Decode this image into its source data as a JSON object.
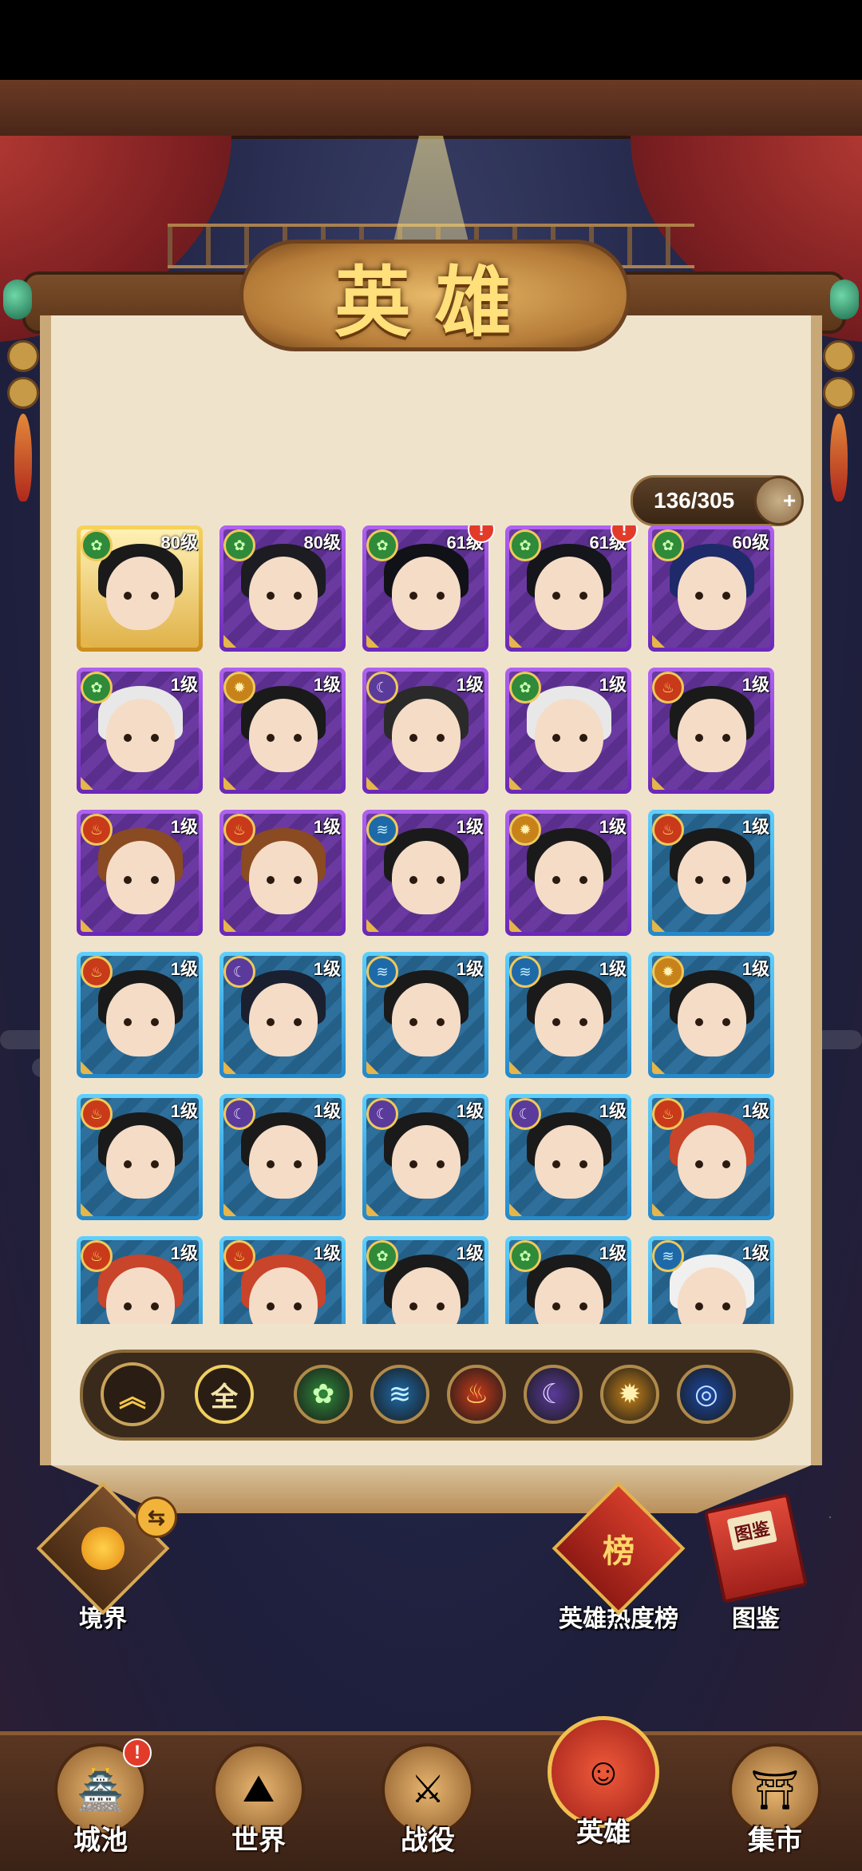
{
  "title": "英雄",
  "capacity": "136/305",
  "capacity_add_icon": "plus-icon",
  "heroes": [
    {
      "level": "80级",
      "element": "nature",
      "frame": "gold",
      "alert": false,
      "hair": "#1a1a1a"
    },
    {
      "level": "80级",
      "element": "nature",
      "frame": "purple",
      "alert": false,
      "hair": "#1c1c22"
    },
    {
      "level": "61级",
      "element": "nature",
      "frame": "purple",
      "alert": true,
      "hair": "#111118"
    },
    {
      "level": "61级",
      "element": "nature",
      "frame": "purple",
      "alert": true,
      "hair": "#15151c"
    },
    {
      "level": "60级",
      "element": "nature",
      "frame": "purple",
      "alert": false,
      "hair": "#1f2a6a"
    },
    {
      "level": "1级",
      "element": "nature",
      "frame": "purple",
      "alert": false,
      "hair": "#e8e8e8"
    },
    {
      "level": "1级",
      "element": "sun",
      "frame": "purple",
      "alert": false,
      "hair": "#1a1a1a"
    },
    {
      "level": "1级",
      "element": "moon",
      "frame": "purple",
      "alert": false,
      "hair": "#2a2a2a"
    },
    {
      "level": "1级",
      "element": "nature",
      "frame": "purple",
      "alert": false,
      "hair": "#e8e8e8"
    },
    {
      "level": "1级",
      "element": "fire",
      "frame": "purple",
      "alert": false,
      "hair": "#1a1a1a"
    },
    {
      "level": "1级",
      "element": "fire",
      "frame": "purple",
      "alert": false,
      "hair": "#8a4a22"
    },
    {
      "level": "1级",
      "element": "fire",
      "frame": "purple",
      "alert": false,
      "hair": "#8a4a22"
    },
    {
      "level": "1级",
      "element": "water",
      "frame": "purple",
      "alert": false,
      "hair": "#1a1a1a"
    },
    {
      "level": "1级",
      "element": "sun",
      "frame": "purple",
      "alert": false,
      "hair": "#1a1a1a"
    },
    {
      "level": "1级",
      "element": "fire",
      "frame": "blue",
      "alert": false,
      "hair": "#1a1a1a"
    },
    {
      "level": "1级",
      "element": "fire",
      "frame": "blue",
      "alert": false,
      "hair": "#1a1a1a"
    },
    {
      "level": "1级",
      "element": "moon",
      "frame": "blue",
      "alert": false,
      "hair": "#1a2030"
    },
    {
      "level": "1级",
      "element": "water",
      "frame": "blue",
      "alert": false,
      "hair": "#1a1a1a"
    },
    {
      "level": "1级",
      "element": "water",
      "frame": "blue",
      "alert": false,
      "hair": "#1a1a1a"
    },
    {
      "level": "1级",
      "element": "sun",
      "frame": "blue",
      "alert": false,
      "hair": "#1a1a1a"
    },
    {
      "level": "1级",
      "element": "fire",
      "frame": "blue",
      "alert": false,
      "hair": "#1a1a1a"
    },
    {
      "level": "1级",
      "element": "moon",
      "frame": "blue",
      "alert": false,
      "hair": "#1a1a1a"
    },
    {
      "level": "1级",
      "element": "moon",
      "frame": "blue",
      "alert": false,
      "hair": "#1a1a1a"
    },
    {
      "level": "1级",
      "element": "moon",
      "frame": "blue",
      "alert": false,
      "hair": "#1a1a1a"
    },
    {
      "level": "1级",
      "element": "fire",
      "frame": "blue",
      "alert": false,
      "hair": "#c8442a"
    },
    {
      "level": "1级",
      "element": "fire",
      "frame": "blue",
      "alert": false,
      "hair": "#c8442a"
    },
    {
      "level": "1级",
      "element": "fire",
      "frame": "blue",
      "alert": false,
      "hair": "#c8442a"
    },
    {
      "level": "1级",
      "element": "nature",
      "frame": "blue",
      "alert": false,
      "hair": "#1a1a1a"
    },
    {
      "level": "1级",
      "element": "nature",
      "frame": "blue",
      "alert": false,
      "hair": "#1a1a1a"
    },
    {
      "level": "1级",
      "element": "water",
      "frame": "blue",
      "alert": false,
      "hair": "#f0f0f0"
    }
  ],
  "element_styles": {
    "nature": {
      "bg": "#2f8a3a",
      "glyph": "✿",
      "color": "#c8ffb0"
    },
    "sun": {
      "bg": "#c7821a",
      "glyph": "✹",
      "color": "#fff2b0"
    },
    "moon": {
      "bg": "#5a3a9a",
      "glyph": "☾",
      "color": "#e8d8ff"
    },
    "fire": {
      "bg": "#c83a1a",
      "glyph": "♨",
      "color": "#ffd36a"
    },
    "water": {
      "bg": "#1e6aa8",
      "glyph": "≋",
      "color": "#c8f0ff"
    },
    "storm": {
      "bg": "#1a4aa8",
      "glyph": "◎",
      "color": "#c8e0ff"
    }
  },
  "filters": {
    "sort_icon": "double-chevron-up-icon",
    "all_label": "全",
    "elements": [
      "nature",
      "water",
      "fire",
      "moon",
      "sun",
      "storm"
    ]
  },
  "side": {
    "realm_label": "境界",
    "ranking_label": "英雄热度榜",
    "ranking_badge": "榜",
    "codex_label": "图鉴",
    "codex_badge": "图鉴"
  },
  "tabs": [
    {
      "label": "城池",
      "icon": "city-icon",
      "glyph": "🏯",
      "alert": true,
      "active": false
    },
    {
      "label": "世界",
      "icon": "world-icon",
      "glyph": "⛰",
      "alert": false,
      "active": false
    },
    {
      "label": "战役",
      "icon": "battle-icon",
      "glyph": "⚔",
      "alert": false,
      "active": false
    },
    {
      "label": "英雄",
      "icon": "hero-icon",
      "glyph": "☺",
      "alert": false,
      "active": true
    },
    {
      "label": "集市",
      "icon": "market-icon",
      "glyph": "⛩",
      "alert": false,
      "active": false
    }
  ],
  "alert_mark": "!"
}
